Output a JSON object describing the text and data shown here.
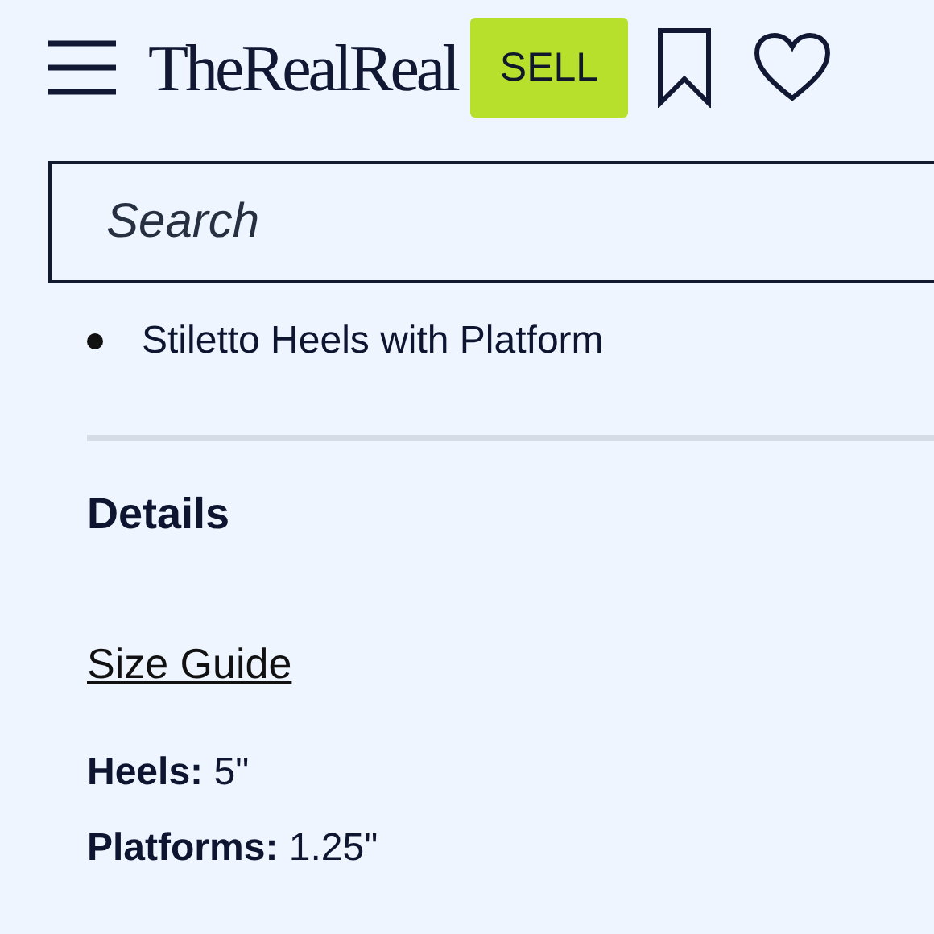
{
  "header": {
    "logo": "TheRealReal",
    "sell_button": "SELL"
  },
  "search": {
    "placeholder": "Search"
  },
  "bullets": [
    "Stiletto Heels with Platform"
  ],
  "details": {
    "title": "Details",
    "size_guide": "Size Guide",
    "specs": [
      "**Heels:** 5\"",
      "**Platforms:** 1.25\""
    ]
  }
}
